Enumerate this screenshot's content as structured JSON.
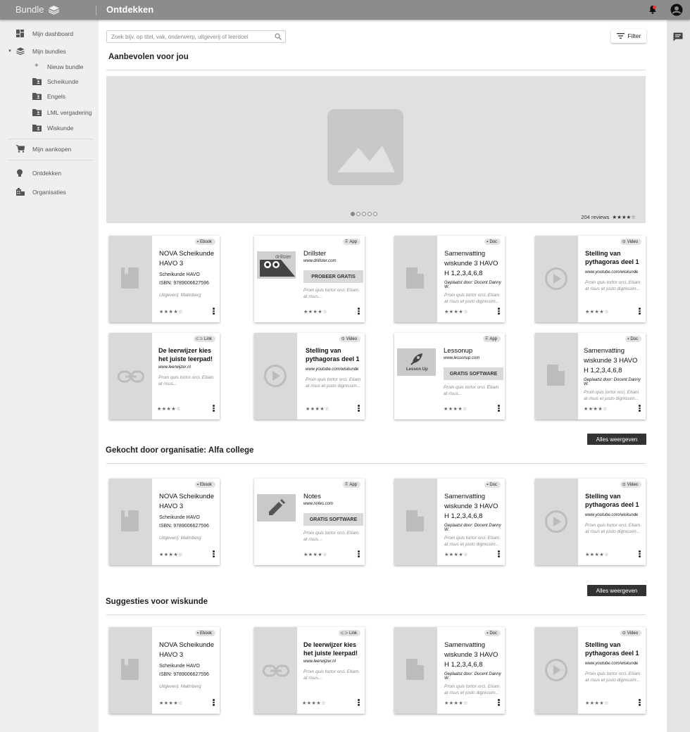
{
  "app": {
    "brand": "Bundle",
    "page_title": "Ontdekken"
  },
  "sidebar": {
    "dashboard": "Mijn dashboard",
    "bundles": "Mijn bundles",
    "sub": [
      "Nieuw bundle",
      "Scheikunde",
      "Engels",
      "LML vergadering",
      "Wiskunde"
    ],
    "purchases": "Mijn aankopen",
    "discover": "Ontdekken",
    "organisations": "Organisaties"
  },
  "search": {
    "placeholder": "Zoek bijv. op titel, vak, onderwerp, uitgeverij of leerdoel"
  },
  "filter_label": "Filter",
  "sections": {
    "recommended": "Aanbevolen voor jou",
    "bought": "Gekocht door organisatie: Alfa college",
    "suggestions": "Suggesties voor wiskunde"
  },
  "hero": {
    "reviews": "204 reviews",
    "stars": "★★★★☆"
  },
  "show_all": "Alles weergeven",
  "badges": {
    "ebook": "Ebook",
    "app": "App",
    "doc": "Doc",
    "video": "Video",
    "link": "Link"
  },
  "ebook": {
    "title": "NOVA Scheikunde HAVO 3",
    "subject": "Scheikunde HAVO",
    "isbn": "ISBN: 9789006627596",
    "publisher": "Uitgeverij: Malmberg"
  },
  "doc": {
    "title": "Samenvatting wiskunde 3 HAVO H 1,2,3,4,6,8",
    "posted": "Geplaatst door: Docent Danny W."
  },
  "video": {
    "title": "Stelling van pythagoras deel 1",
    "url": "www.youtube.com/wiskunde"
  },
  "link": {
    "title": "De leerwijzer kies het juiste leerpad!",
    "url": "www.leerwijzer.nl"
  },
  "drillster": {
    "title": "Drillster",
    "url": "www.drillster.com",
    "cta": "PROBEER GRATIS",
    "logo_text": "drillster"
  },
  "lessonup": {
    "title": "Lessonup",
    "url": "www.lessonup.com",
    "cta": "GRATIS SOFTWARE",
    "logo_text": "Lesson Up"
  },
  "notes": {
    "title": "Notes",
    "url": "www.notes.com",
    "cta": "GRATIS SOFTWARE"
  },
  "desc": "Proin quis tortor orci. Etiam at risus et justo dignissim...",
  "desc_short": "Proin quis tortor orci. Etiam at risus...",
  "card_stars": "★★★★☆"
}
